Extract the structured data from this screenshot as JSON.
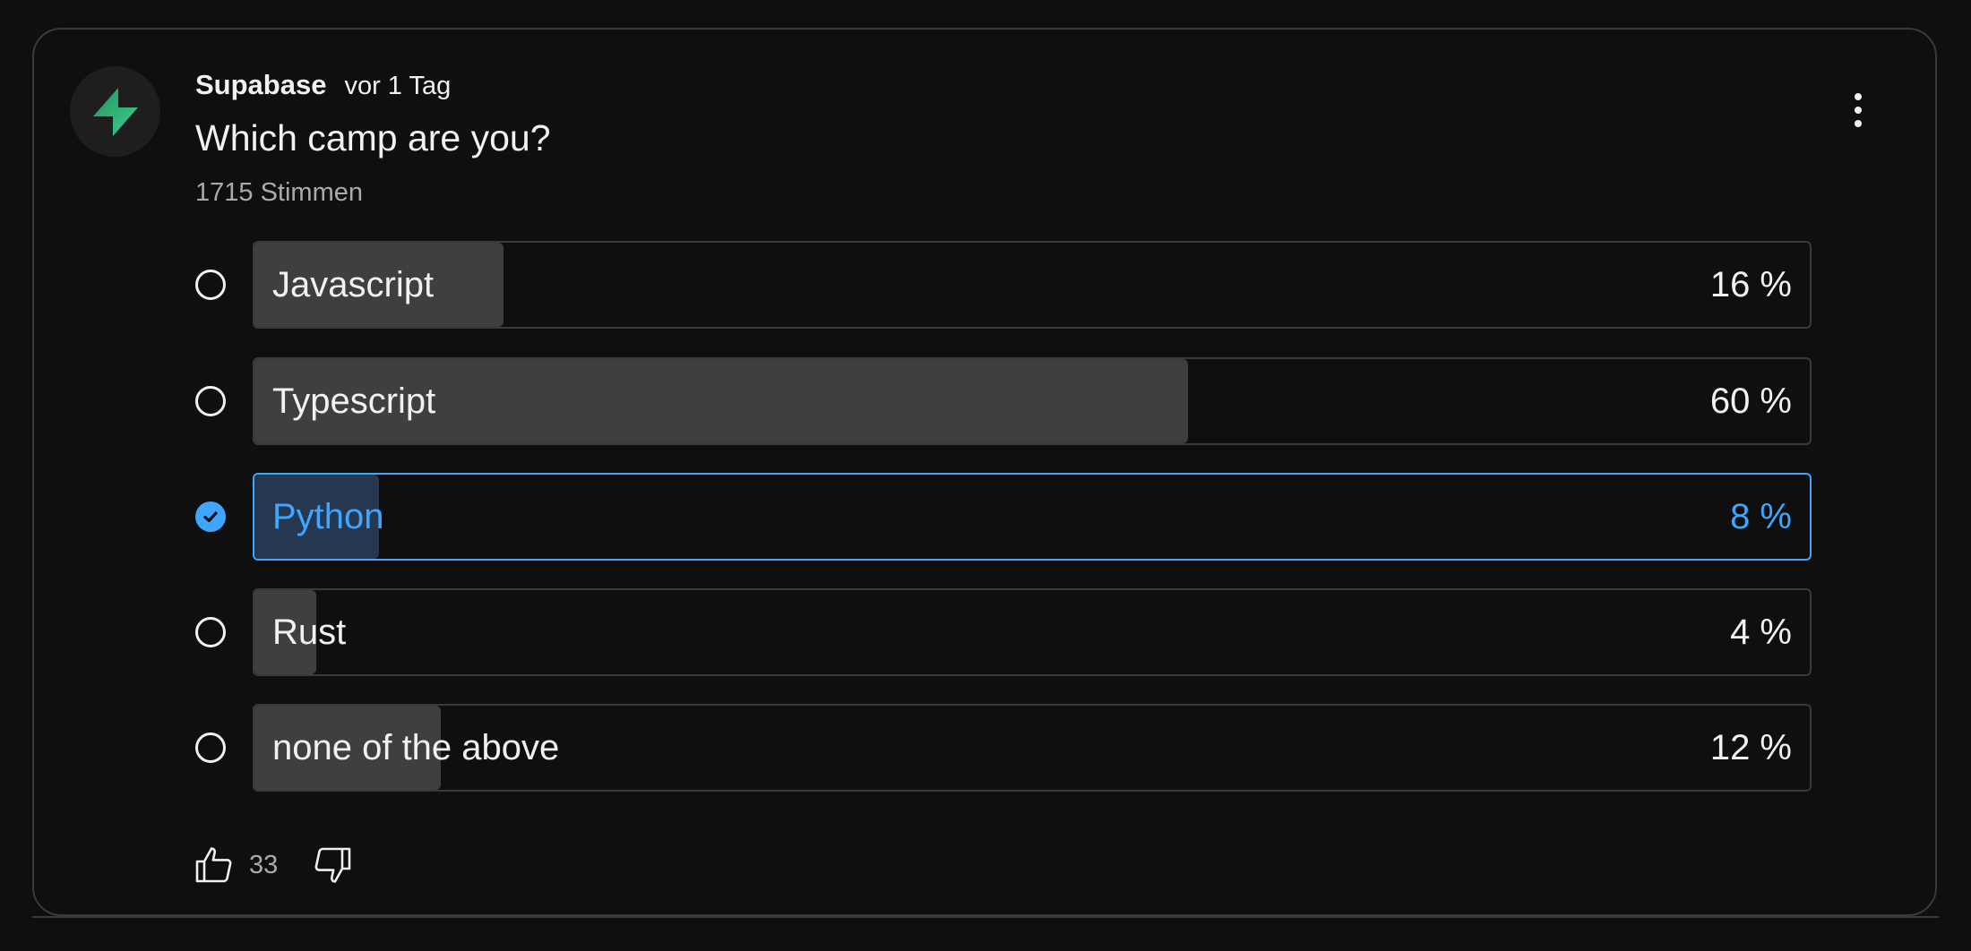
{
  "post": {
    "author": "Supabase",
    "time": "vor 1 Tag",
    "question": "Which camp are you?",
    "votes_text": "1715 Stimmen",
    "avatar_icon": "supabase-bolt-icon",
    "menu_icon": "more-vertical-icon"
  },
  "poll": {
    "options": [
      {
        "label": "Javascript",
        "percent_text": "16 %",
        "percent": 16,
        "selected": false
      },
      {
        "label": "Typescript",
        "percent_text": "60 %",
        "percent": 60,
        "selected": false
      },
      {
        "label": "Python",
        "percent_text": "8 %",
        "percent": 8,
        "selected": true
      },
      {
        "label": "Rust",
        "percent_text": "4 %",
        "percent": 4,
        "selected": false
      },
      {
        "label": "none of the above",
        "percent_text": "12 %",
        "percent": 12,
        "selected": false
      }
    ]
  },
  "actions": {
    "like_count": "33",
    "like_icon": "thumbs-up-icon",
    "dislike_icon": "thumbs-down-icon"
  },
  "colors": {
    "background": "#0f0f0f",
    "accent": "#3ea6ff",
    "brand": "#3ecf8e",
    "fill": "#3f3f3f",
    "selected_fill": "#263850"
  }
}
